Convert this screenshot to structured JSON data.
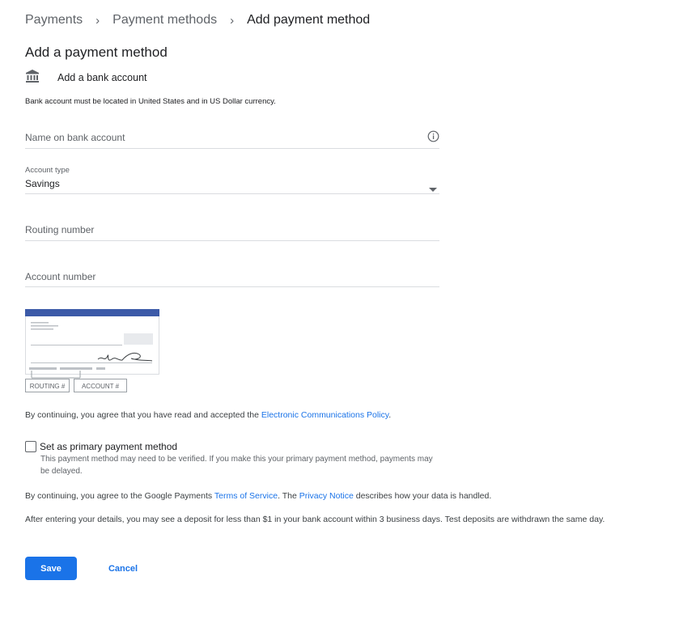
{
  "breadcrumb": {
    "items": [
      "Payments",
      "Payment methods"
    ],
    "current": "Add payment method",
    "separator": "›"
  },
  "page_title": "Add a payment method",
  "bank": {
    "icon": "bank-icon",
    "label": "Add a bank account",
    "notice": "Bank account must be located in United States and in US Dollar currency."
  },
  "form": {
    "name_placeholder": "Name on bank account",
    "name_info_icon": "info-icon",
    "account_type_label": "Account type",
    "account_type_value": "Savings",
    "routing_placeholder": "Routing number",
    "account_placeholder": "Account number"
  },
  "check_image": {
    "routing_label": "ROUTING #",
    "account_label": "ACCOUNT #"
  },
  "agreement1": {
    "text": "By continuing, you agree that you have read and accepted the ",
    "link": "Electronic Communications Policy",
    "end": "."
  },
  "primary": {
    "label": "Set as primary payment method",
    "checked": false,
    "help": "This payment method may need to be verified. If you make this your primary payment method, payments may be delayed."
  },
  "agreement2": {
    "text1": "By continuing, you agree to the Google Payments ",
    "tos_link": "Terms of Service",
    "text2": ". The ",
    "privacy_link": "Privacy Notice",
    "text3": " describes how your data is handled."
  },
  "deposit_notice": "After entering your details, you may see a deposit for less than $1 in your bank account within 3 business days. Test deposits are withdrawn the same day.",
  "buttons": {
    "save": "Save",
    "cancel": "Cancel"
  },
  "colors": {
    "accent": "#1a73e8",
    "check_header": "#3c5aa8"
  }
}
